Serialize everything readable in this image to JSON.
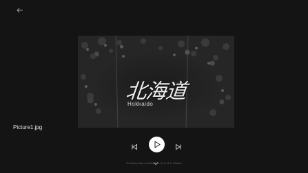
{
  "viewer": {
    "photo": {
      "title_text": "北海道",
      "subtitle_text": "Hokkaido"
    },
    "file_name": "Picture1.jpg",
    "caption": "Get this photo on Windows 10 & 11 in Photos",
    "icons": {
      "back": "arrow-left-icon",
      "previous": "skip-previous-icon",
      "play": "play-icon",
      "next": "skip-next-icon",
      "expand": "chevron-down-icon"
    },
    "colors": {
      "background": "#141414",
      "play_button": "#ffffff",
      "text": "#e6e6e6"
    }
  }
}
